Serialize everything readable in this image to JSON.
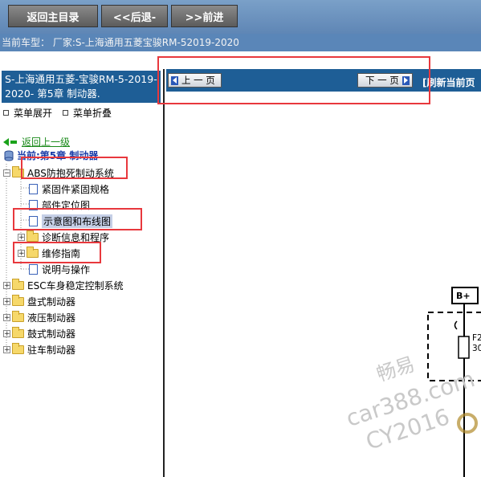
{
  "toolbar": {
    "home_label": "返回主目录",
    "back_label": "<<后退-",
    "forward_label": ">>前进"
  },
  "carbar": {
    "text": "当前车型： 厂家:S-上海通用五菱宝骏RM-52019-2020"
  },
  "left": {
    "header": "S-上海通用五菱-宝骏RM-5-2019-2020- 第5章 制动器.",
    "expand_label": "菜单展开",
    "collapse_label": "菜单折叠",
    "back_up_label": "返回上一级",
    "current_label": "当前:第5章 制动器",
    "tree": [
      {
        "label": "ABS防抱死制动系统",
        "toggle": "−",
        "kind": "folder"
      },
      {
        "label": "紧固件紧固规格",
        "kind": "doc"
      },
      {
        "label": "部件定位图",
        "kind": "doc"
      },
      {
        "label": "示意图和布线图",
        "kind": "doc"
      },
      {
        "label": "诊断信息和程序",
        "toggle": "+",
        "kind": "folder"
      },
      {
        "label": "维修指南",
        "toggle": "+",
        "kind": "folder"
      },
      {
        "label": "说明与操作",
        "kind": "doc"
      },
      {
        "label": "ESC车身稳定控制系统",
        "toggle": "+",
        "kind": "folder"
      },
      {
        "label": "盘式制动器",
        "toggle": "+",
        "kind": "folder"
      },
      {
        "label": "液压制动器",
        "toggle": "+",
        "kind": "folder"
      },
      {
        "label": "鼓式制动器",
        "toggle": "+",
        "kind": "folder"
      },
      {
        "label": "驻车制动器",
        "toggle": "+",
        "kind": "folder"
      }
    ]
  },
  "right": {
    "prev_label": "上 一 页",
    "next_label": "下 一 页",
    "refresh_label": "[刷新当前页"
  },
  "diagram": {
    "bplus": "B+",
    "fuse_a": "F2",
    "fuse_b": "30"
  },
  "watermark": {
    "line1": "畅易",
    "line2": "car388.com",
    "line3": "CY2016"
  },
  "colors": {
    "header_blue": "#1e5e96",
    "annotation_red": "#e8383d"
  }
}
